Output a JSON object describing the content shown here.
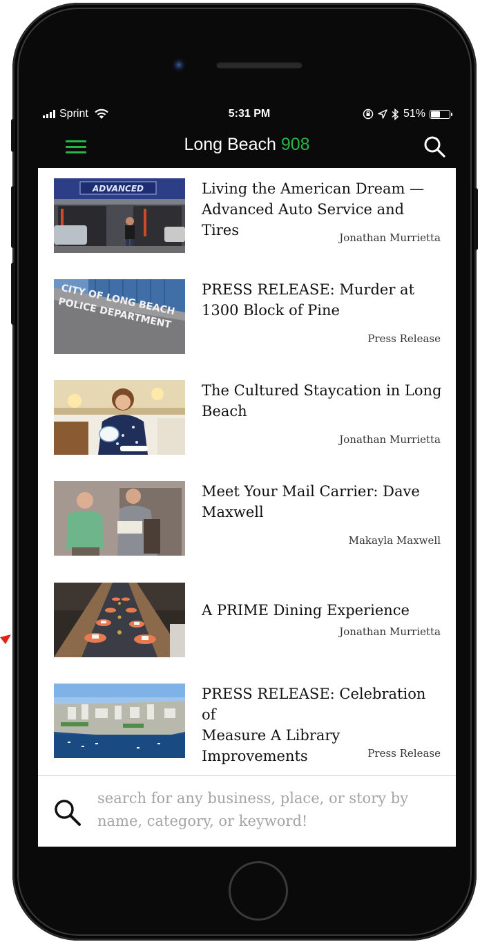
{
  "status_bar": {
    "carrier": "Sprint",
    "time": "5:31 PM",
    "battery": "51%",
    "battery_level": 0.51
  },
  "nav": {
    "title": "Long Beach",
    "title_accent": "908",
    "accent_color": "#28b34b",
    "menu_icon": "hamburger-menu-icon",
    "search_icon": "search-icon"
  },
  "articles": [
    {
      "title_line1": "Living the American Dream —",
      "title_line2": "Advanced Auto Service and Tires",
      "title_line3": "",
      "author": "Jonathan Murrietta",
      "sign_text": "ADVANCED"
    },
    {
      "title_line1": "PRESS RELEASE: Murder at",
      "title_line2": "1300 Block of Pine",
      "title_line3": "",
      "author": "Press Release",
      "sign_line1": "CITY OF LONG BEACH",
      "sign_line2": "POLICE DEPARTMENT"
    },
    {
      "title_line1": "The Cultured Staycation in Long",
      "title_line2": "Beach",
      "title_line3": "",
      "author": "Jonathan Murrietta"
    },
    {
      "title_line1": "Meet Your Mail Carrier: Dave",
      "title_line2": "Maxwell",
      "title_line3": "",
      "author": "Makayla Maxwell"
    },
    {
      "title_line1": "A PRIME Dining Experience",
      "title_line2": "",
      "title_line3": "",
      "author": "Jonathan Murrietta"
    },
    {
      "title_line1": "PRESS RELEASE: Celebration of",
      "title_line2": "Measure A Library",
      "title_line3": "Improvements",
      "author": "Press Release"
    }
  ],
  "search": {
    "placeholder": "search for any business, place, or story by name, category, or keyword!",
    "value": ""
  }
}
